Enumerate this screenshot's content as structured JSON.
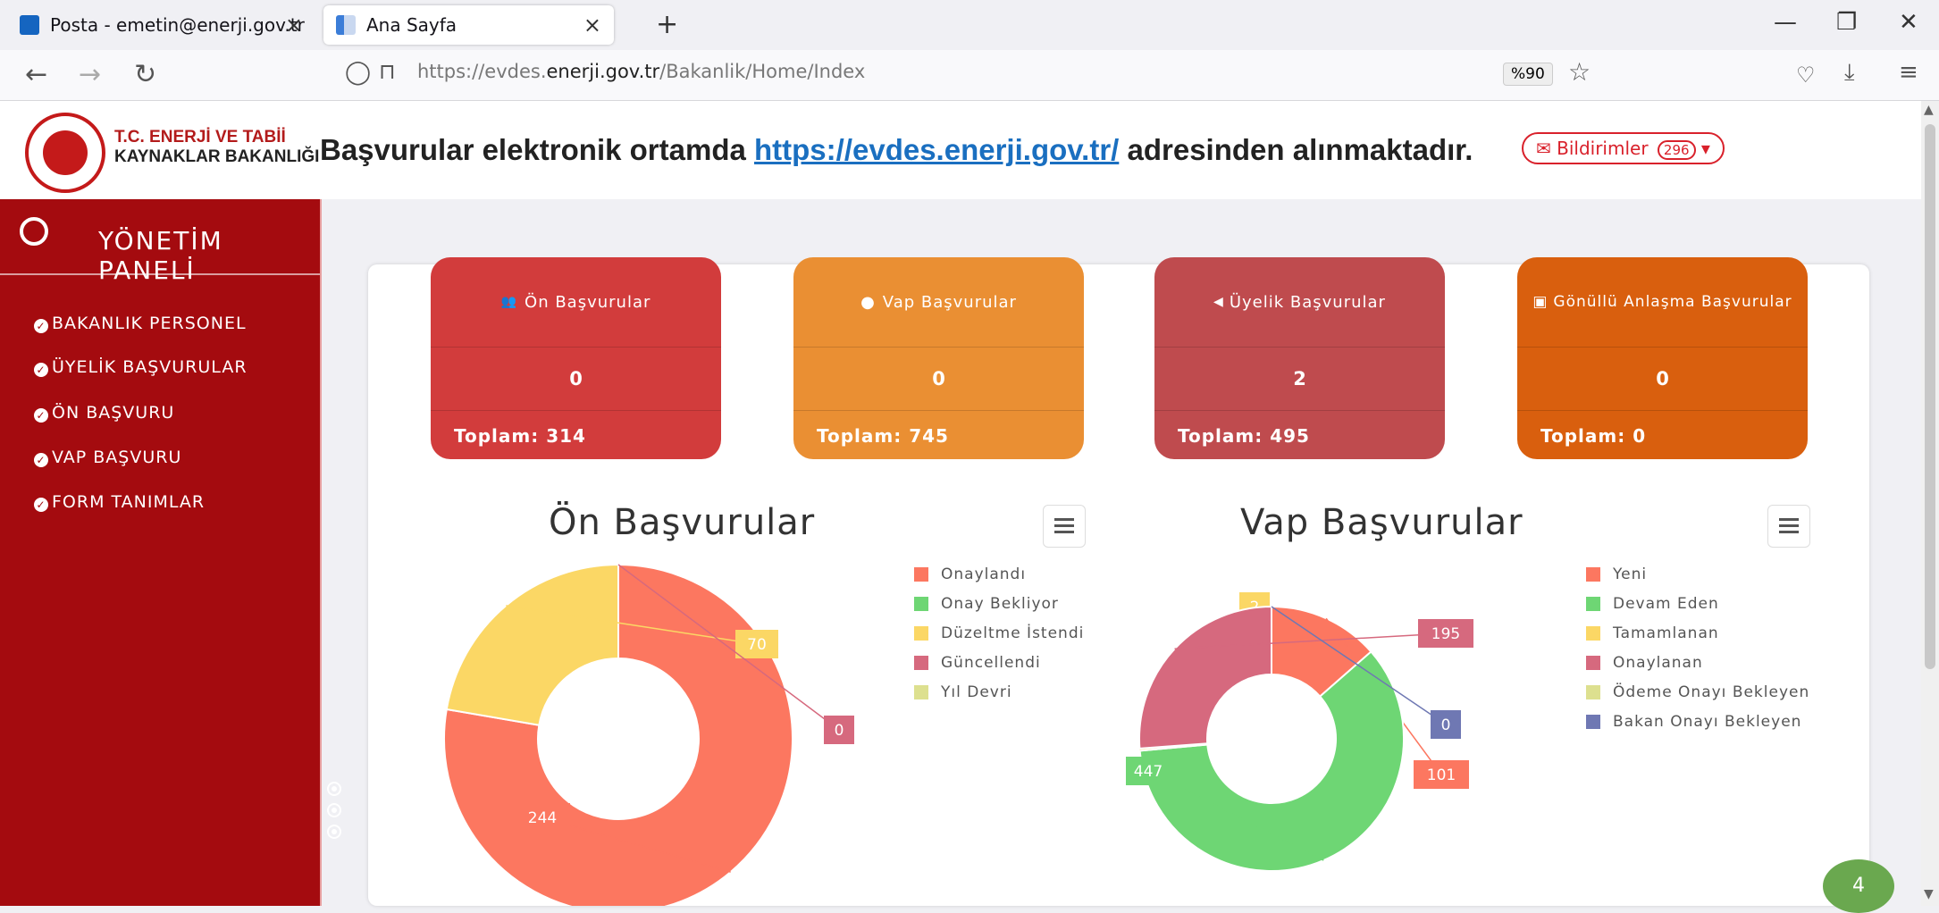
{
  "browser": {
    "tabs": [
      {
        "label": "Posta - emetin@enerji.gov.tr",
        "close": "×"
      },
      {
        "label": "Ana Sayfa",
        "close": "×"
      }
    ],
    "new_tab": "+",
    "window_controls": {
      "minimize": "—",
      "maximize": "❐",
      "close": "✕"
    },
    "url_prefix": "https://evdes.",
    "url_domain": "enerji.gov.tr",
    "url_path": "/Bakanlik/Home/Index",
    "zoom": "%90"
  },
  "header": {
    "logo_line1": "T.C. ENERJİ VE TABİİ",
    "logo_line2": "KAYNAKLAR BAKANLIĞI",
    "announce_before": "Başvurular elektronik ortamda ",
    "announce_link": "https://evdes.enerji.gov.tr/",
    "announce_after": " adresinden alınmaktadır.",
    "notifications_label": "Bildirimler",
    "notifications_count": "296"
  },
  "sidebar": {
    "title": "YÖNETİM PANELİ",
    "items": [
      {
        "label": "BAKANLIK PERSONEL"
      },
      {
        "label": "ÜYELİK BAŞVURULAR"
      },
      {
        "label": "ÖN BAŞVURU"
      },
      {
        "label": "VAP BAŞVURU"
      },
      {
        "label": "FORM TANIMLAR"
      }
    ]
  },
  "cards": [
    {
      "icon": "👥",
      "title": "Ön Başvurular",
      "value": "0",
      "total": "Toplam: 314",
      "color": "#d23c3c"
    },
    {
      "icon": "●",
      "title": "Vap Başvurular",
      "value": "0",
      "total": "Toplam: 745",
      "color": "#ea8f33"
    },
    {
      "icon": "◀",
      "title": "Üyelik Başvurular",
      "value": "2",
      "total": "Toplam: 495",
      "color": "#bf4b4e"
    },
    {
      "icon": "▣",
      "title": "Gönüllü Anlaşma Başvurular",
      "value": "0",
      "total": "Toplam: 0",
      "color": "#d95f0e"
    }
  ],
  "chart_data": [
    {
      "type": "pie",
      "title": "Ön Başvurular",
      "categories": [
        "Onaylandı",
        "Onay Bekliyor",
        "Düzeltme İstendi",
        "Güncellendi",
        "Yıl Devri"
      ],
      "values": [
        244,
        0,
        70,
        0,
        0
      ],
      "colors": [
        "#fc7760",
        "#6ed674",
        "#fbd765",
        "#d6697e",
        "#dde08f"
      ],
      "legend": "right"
    },
    {
      "type": "pie",
      "title": "Vap Başvurular",
      "categories": [
        "Yeni",
        "Devam Eden",
        "Tamamlanan",
        "Onaylanan",
        "Ödeme Onayı Bekleyen",
        "Bakan Onayı Bekleyen"
      ],
      "values": [
        101,
        447,
        2,
        195,
        0,
        0
      ],
      "colors": [
        "#fc7760",
        "#6ed674",
        "#fbd765",
        "#d6697e",
        "#dde08f",
        "#6f78b3"
      ],
      "legend": "right"
    }
  ],
  "page_number": "4"
}
